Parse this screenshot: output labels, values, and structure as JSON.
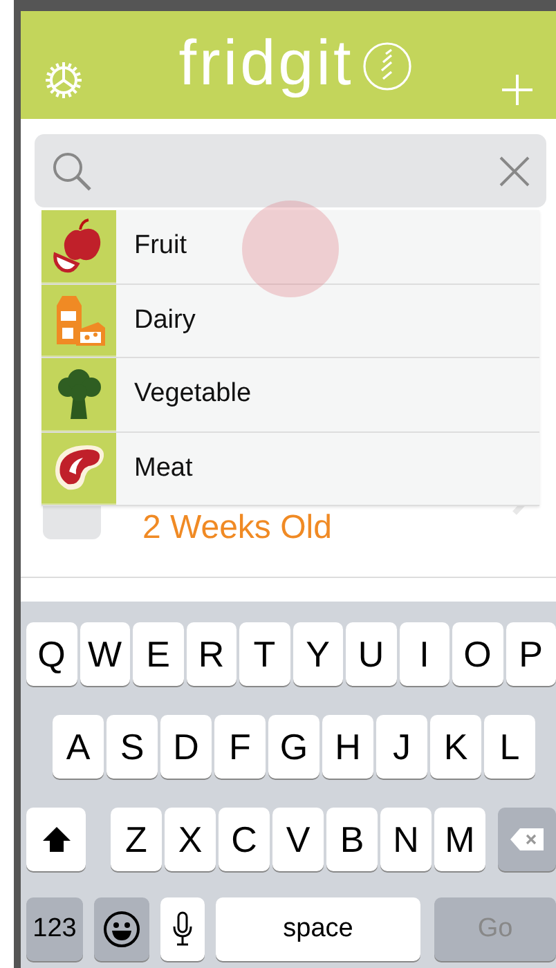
{
  "header": {
    "title": "fridgit"
  },
  "categories": [
    {
      "label": "Fruit",
      "kind": "fruit"
    },
    {
      "label": "Dairy",
      "kind": "dairy"
    },
    {
      "label": "Vegetable",
      "kind": "vegetable"
    },
    {
      "label": "Meat",
      "kind": "meat"
    }
  ],
  "food_item": {
    "age": "2 Weeks Old"
  },
  "keyboard": {
    "rows": [
      [
        "Q",
        "W",
        "E",
        "R",
        "T",
        "Y",
        "U",
        "I",
        "O",
        "P"
      ],
      [
        "A",
        "S",
        "D",
        "F",
        "G",
        "H",
        "J",
        "K",
        "L"
      ],
      [
        "Z",
        "X",
        "C",
        "V",
        "B",
        "N",
        "M"
      ]
    ],
    "numbers_key": "123",
    "space_key": "space",
    "go_key": {
      "label": "Go",
      "disabled": true
    }
  }
}
